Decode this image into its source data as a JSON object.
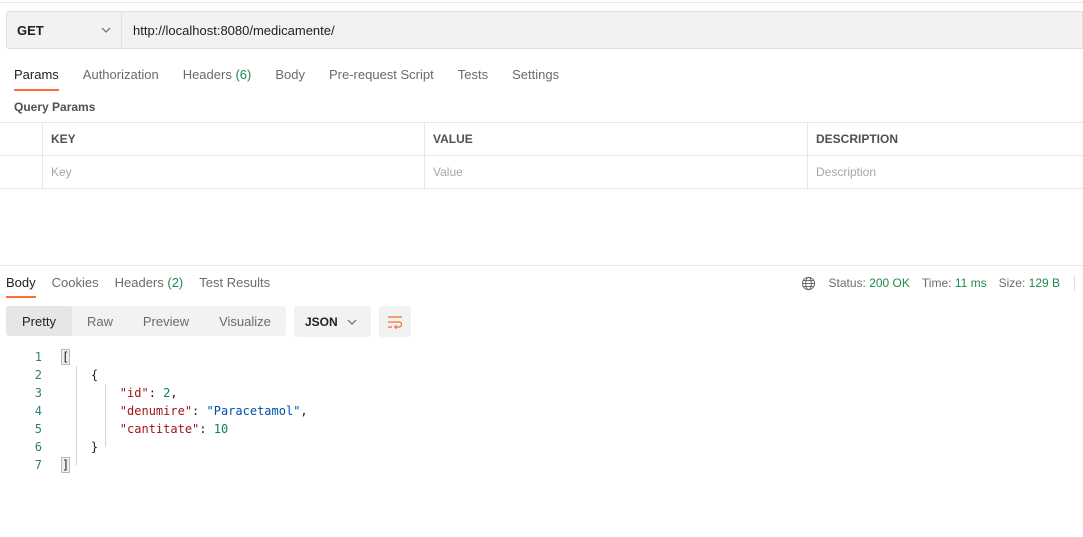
{
  "request": {
    "method": "GET",
    "url": "http://localhost:8080/medicamente/"
  },
  "request_tabs": [
    {
      "label": "Params",
      "active": true
    },
    {
      "label": "Authorization"
    },
    {
      "label": "Headers",
      "count": "(6)"
    },
    {
      "label": "Body"
    },
    {
      "label": "Pre-request Script"
    },
    {
      "label": "Tests"
    },
    {
      "label": "Settings"
    }
  ],
  "query_params": {
    "title": "Query Params",
    "headers": [
      "KEY",
      "VALUE",
      "DESCRIPTION"
    ],
    "placeholders": [
      "Key",
      "Value",
      "Description"
    ]
  },
  "response_tabs": [
    {
      "label": "Body",
      "active": true
    },
    {
      "label": "Cookies"
    },
    {
      "label": "Headers",
      "count": "(2)"
    },
    {
      "label": "Test Results"
    }
  ],
  "response_meta": {
    "status_label": "Status:",
    "status_value": "200 OK",
    "time_label": "Time:",
    "time_value": "11 ms",
    "size_label": "Size:",
    "size_value": "129 B"
  },
  "view_modes": [
    "Pretty",
    "Raw",
    "Preview",
    "Visualize"
  ],
  "language": "JSON",
  "code_lines": {
    "numbers": [
      "1",
      "2",
      "3",
      "4",
      "5",
      "6",
      "7"
    ],
    "l1": "[",
    "l2": "{",
    "l3_key": "\"id\"",
    "l3_val": "2",
    "l4_key": "\"denumire\"",
    "l4_val": "\"Paracetamol\"",
    "l5_key": "\"cantitate\"",
    "l5_val": "10",
    "l6": "}",
    "l7": "]"
  },
  "accent_color": "#ff6c37",
  "success_color": "#1e8a4c"
}
